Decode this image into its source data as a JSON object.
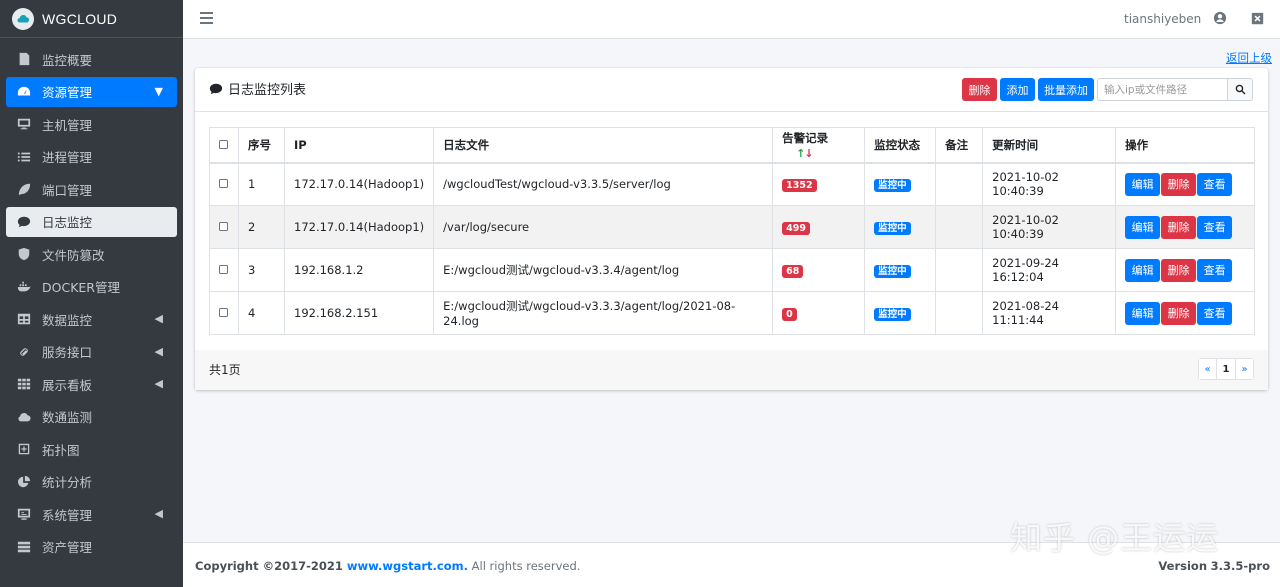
{
  "brand": {
    "name": "WGCLOUD"
  },
  "sidebar": {
    "items": [
      {
        "label": "监控概要",
        "icon": "document-icon"
      },
      {
        "label": "资源管理",
        "icon": "dashboard-icon",
        "expanded": true
      },
      {
        "label": "主机管理",
        "icon": "desktop-icon"
      },
      {
        "label": "进程管理",
        "icon": "list-icon"
      },
      {
        "label": "端口管理",
        "icon": "leaf-icon"
      },
      {
        "label": "日志监控",
        "icon": "comment-icon",
        "selected": true
      },
      {
        "label": "文件防篡改",
        "icon": "shield-icon"
      },
      {
        "label": "DOCKER管理",
        "icon": "docker-icon"
      },
      {
        "label": "数据监控",
        "icon": "table-icon",
        "has_submenu": true
      },
      {
        "label": "服务接口",
        "icon": "link-icon",
        "has_submenu": true
      },
      {
        "label": "展示看板",
        "icon": "grid-icon",
        "has_submenu": true
      },
      {
        "label": "数通监测",
        "icon": "cloud-icon"
      },
      {
        "label": "拓扑图",
        "icon": "plus-square-icon"
      },
      {
        "label": "统计分析",
        "icon": "pie-icon"
      },
      {
        "label": "系统管理",
        "icon": "monitor-icon",
        "has_submenu": true
      },
      {
        "label": "资产管理",
        "icon": "database-icon"
      }
    ]
  },
  "topbar": {
    "username": "tianshiyeben"
  },
  "return_link": "返回上级",
  "card": {
    "title": "日志监控列表",
    "buttons": {
      "delete": "删除",
      "add": "添加",
      "batch_add": "批量添加"
    },
    "search_placeholder": "输入ip或文件路径"
  },
  "table": {
    "headers": [
      "序号",
      "IP",
      "日志文件",
      "告警记录",
      "监控状态",
      "备注",
      "更新时间",
      "操作"
    ],
    "rows": [
      {
        "index": "1",
        "ip": "172.17.0.14(Hadoop1)",
        "file": "/wgcloudTest/wgcloud-v3.3.5/server/log",
        "alerts": "1352",
        "status": "监控中",
        "note": "",
        "updated": "2021-10-02 10:40:39"
      },
      {
        "index": "2",
        "ip": "172.17.0.14(Hadoop1)",
        "file": "/var/log/secure",
        "alerts": "499",
        "status": "监控中",
        "note": "",
        "updated": "2021-10-02 10:40:39"
      },
      {
        "index": "3",
        "ip": "192.168.1.2",
        "file": "E:/wgcloud测试/wgcloud-v3.3.4/agent/log",
        "alerts": "68",
        "status": "监控中",
        "note": "",
        "updated": "2021-09-24 16:12:04"
      },
      {
        "index": "4",
        "ip": "192.168.2.151",
        "file": "E:/wgcloud测试/wgcloud-v3.3.3/agent/log/2021-08-24.log",
        "alerts": "0",
        "status": "监控中",
        "note": "",
        "updated": "2021-08-24 11:11:44"
      }
    ],
    "actions": {
      "edit": "编辑",
      "delete": "删除",
      "view": "查看"
    }
  },
  "pagination": {
    "total_text": "共1页",
    "prev": "«",
    "current": "1",
    "next": "»"
  },
  "footer": {
    "copyright_prefix": "Copyright ©2017-2021 ",
    "site": "www.wgstart.com.",
    "suffix": " All rights reserved.",
    "version_label": "Version",
    "version": "3.3.5-pro"
  },
  "watermark": "知乎 @王运运",
  "colors": {
    "sidebar_bg": "#343a40",
    "primary": "#007bff",
    "danger": "#dc3545"
  }
}
